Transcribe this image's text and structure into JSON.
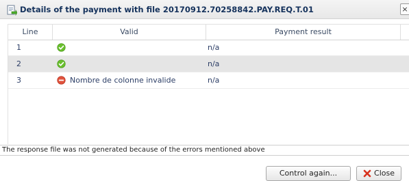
{
  "dialog": {
    "title": "Details of the payment with file 20170912.70258842.PAY.REQ.T.01",
    "title_icon": "file-export-icon",
    "close_glyph": "×"
  },
  "grid": {
    "columns": [
      "Line",
      "Valid",
      "Payment result"
    ],
    "rows": [
      {
        "line": "1",
        "status": "valid",
        "message": "",
        "result": "n/a"
      },
      {
        "line": "2",
        "status": "valid",
        "message": "",
        "result": "n/a"
      },
      {
        "line": "3",
        "status": "invalid",
        "message": "Nombre de colonne invalide",
        "result": "n/a"
      }
    ]
  },
  "footer": {
    "message": "The response file was not generated because of the errors mentioned above"
  },
  "buttons": {
    "control_again": "Control again...",
    "close": "Close"
  },
  "colors": {
    "valid_green": "#6abf2e",
    "error_red": "#e0533d",
    "title_text": "#15325c",
    "selected_row": "#e5e5e5"
  }
}
